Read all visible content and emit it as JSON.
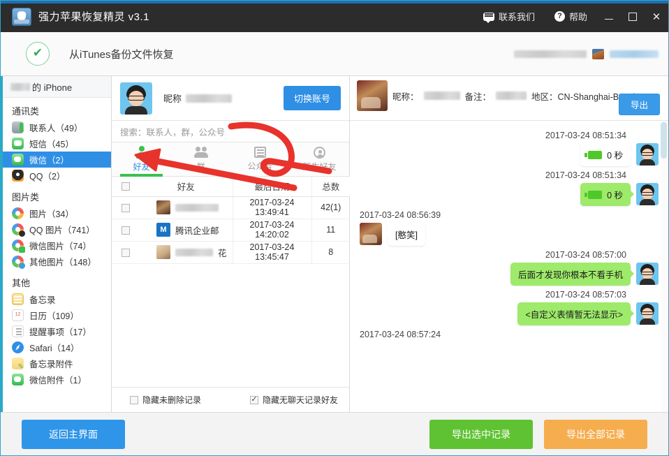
{
  "window": {
    "title": "强力苹果恢复精灵 v3.1",
    "contact_label": "联系我们",
    "help_label": "帮助",
    "help_glyph": "?",
    "minimize": "",
    "maximize": "",
    "close": "✕"
  },
  "header": {
    "title": "从iTunes备份文件恢复"
  },
  "sidebar": {
    "device": "的 iPhone",
    "sections": [
      {
        "title": "通讯类",
        "items": [
          {
            "label": "联系人（49）",
            "icon": "contacts-icon",
            "selected": false
          },
          {
            "label": "短信（45）",
            "icon": "sms-icon",
            "selected": false
          },
          {
            "label": "微信（2）",
            "icon": "wechat-icon",
            "selected": true
          },
          {
            "label": "QQ（2）",
            "icon": "qq-icon",
            "selected": false
          }
        ]
      },
      {
        "title": "图片类",
        "items": [
          {
            "label": "图片（34）",
            "icon": "photos-icon",
            "selected": false
          },
          {
            "label": "QQ 图片（741）",
            "icon": "qq-photos-icon",
            "selected": false
          },
          {
            "label": "微信图片（74）",
            "icon": "wechat-photos-icon",
            "selected": false
          },
          {
            "label": "其他图片（148）",
            "icon": "other-photos-icon",
            "selected": false
          }
        ]
      },
      {
        "title": "其他",
        "items": [
          {
            "label": "备忘录",
            "icon": "notes-icon",
            "selected": false
          },
          {
            "label": "日历（109）",
            "icon": "calendar-icon",
            "selected": false
          },
          {
            "label": "提醒事项（17）",
            "icon": "reminders-icon",
            "selected": false
          },
          {
            "label": "Safari（14）",
            "icon": "safari-icon",
            "selected": false
          },
          {
            "label": "备忘录附件",
            "icon": "notes-attachment-icon",
            "selected": false
          },
          {
            "label": "微信附件（1）",
            "icon": "wechat-attachment-icon",
            "selected": false
          }
        ]
      }
    ]
  },
  "middle": {
    "nickname_label": "昵称",
    "switch_account_label": "切换账号",
    "search_placeholder": "搜索：联系人，群，公众号",
    "tabs": [
      {
        "label": "好友",
        "icon": "friend-icon",
        "active": true
      },
      {
        "label": "群",
        "icon": "group-icon",
        "active": false
      },
      {
        "label": "公众号",
        "icon": "official-account-icon",
        "active": false
      },
      {
        "label": "陌生好友",
        "icon": "stranger-icon",
        "active": false
      }
    ],
    "columns": [
      "好友",
      "最后日期",
      "总数"
    ],
    "rows": [
      {
        "name": "",
        "date": "2017-03-24 13:49:41",
        "total": "42(1)",
        "checked": false
      },
      {
        "name": "腾讯企业邮",
        "date": "2017-03-24 14:20:02",
        "total": "11",
        "checked": false
      },
      {
        "name": "花",
        "date": "2017-03-24 13:45:47",
        "total": "8",
        "checked": false
      }
    ],
    "options": [
      {
        "label": "隐藏未删除记录",
        "checked": false
      },
      {
        "label": "隐藏无聊天记录好友",
        "checked": true
      }
    ]
  },
  "right": {
    "nickname_label": "昵称：",
    "remark_label": "备注：",
    "region_label": "地区：CN-Shanghai-Baoshan",
    "export_label": "导出",
    "messages": [
      {
        "time": "2017-03-24 08:51:34",
        "side": "right",
        "kind": "voice",
        "text": "0 秒",
        "bubble": "white"
      },
      {
        "time": "2017-03-24 08:51:34",
        "side": "right",
        "kind": "voice",
        "text": "0 秒",
        "bubble": "green"
      },
      {
        "time": "2017-03-24 08:56:39",
        "side": "left",
        "kind": "text",
        "text": "[憨笑]",
        "bubble": "white"
      },
      {
        "time": "2017-03-24 08:57:00",
        "side": "right",
        "kind": "text",
        "text": "后面才发现你根本不看手机",
        "bubble": "green"
      },
      {
        "time": "2017-03-24 08:57:03",
        "side": "right",
        "kind": "text",
        "text": "<自定义表情暂无法显示>",
        "bubble": "green"
      },
      {
        "time": "2017-03-24 08:57:24",
        "side": "left",
        "kind": "none",
        "text": "",
        "bubble": "none"
      }
    ]
  },
  "footer": {
    "back_label": "返回主界面",
    "export_selected_label": "导出选中记录",
    "export_all_label": "导出全部记录"
  },
  "colors": {
    "accent_blue": "#2f8fe5",
    "accent_green": "#5fc232",
    "accent_orange": "#f5ad4e",
    "title_bg": "#2c2c2c",
    "annotation_red": "#e8322c",
    "bubble_green": "#9eea6a"
  }
}
